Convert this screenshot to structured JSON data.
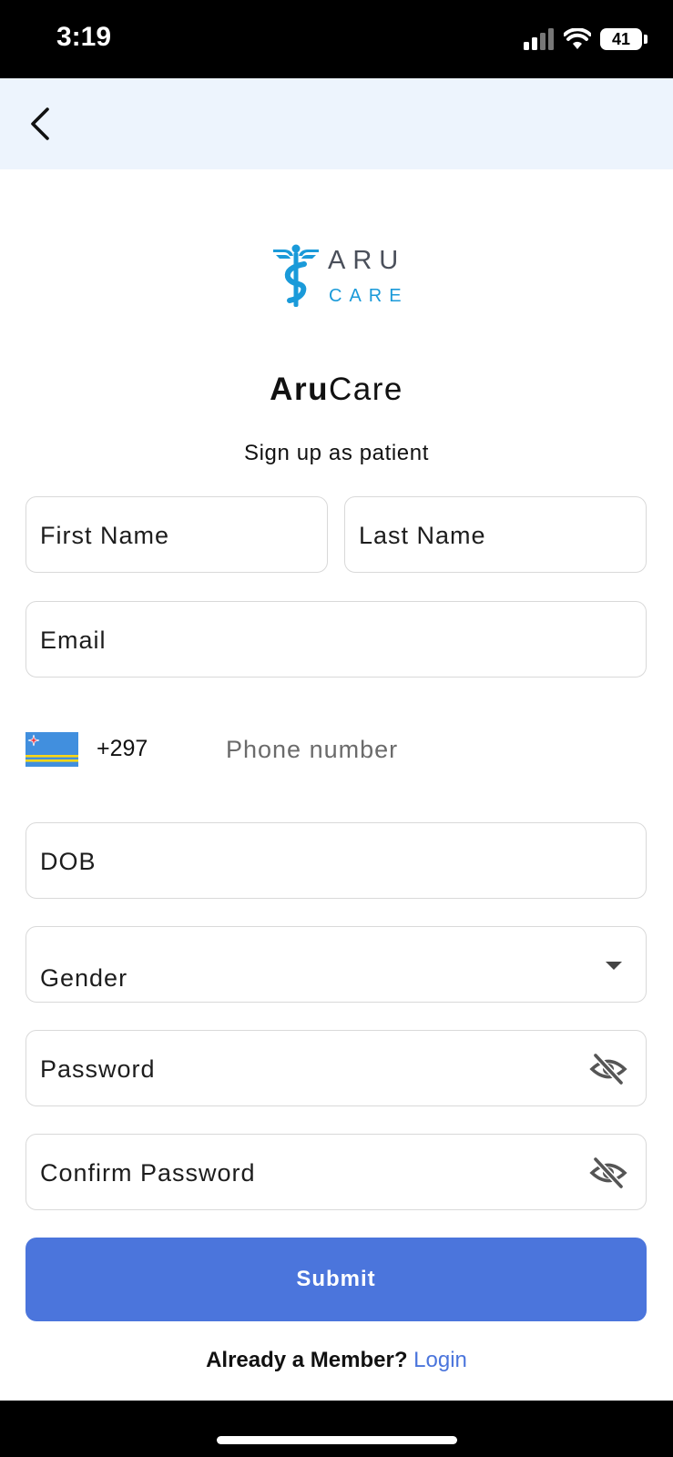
{
  "status_bar": {
    "time": "3:19",
    "battery": "41"
  },
  "header": {
    "back_label": "Back"
  },
  "brand": {
    "logo_line1": "ARU",
    "logo_line2": "CARE",
    "title_bold": "Aru",
    "title_regular": "Care",
    "subtitle": "Sign up as patient"
  },
  "form": {
    "first_name_label": "First Name",
    "last_name_label": "Last Name",
    "email_label": "Email",
    "phone": {
      "dial_code": "+297",
      "placeholder": "Phone number",
      "country_flag": "aruba-flag"
    },
    "dob_label": "DOB",
    "gender_label": "Gender",
    "password_label": "Password",
    "confirm_password_label": "Confirm Password"
  },
  "submit_label": "Submit",
  "footer": {
    "member_text": "Already a Member?",
    "login_link": "Login"
  },
  "colors": {
    "accent": "#4b75dc",
    "logo_blue": "#1a9ad9",
    "header_bg": "#edf4fd"
  },
  "icons": {
    "back": "chevron-left-icon",
    "eye": "eye-off-icon",
    "dropdown": "caret-down-icon"
  }
}
